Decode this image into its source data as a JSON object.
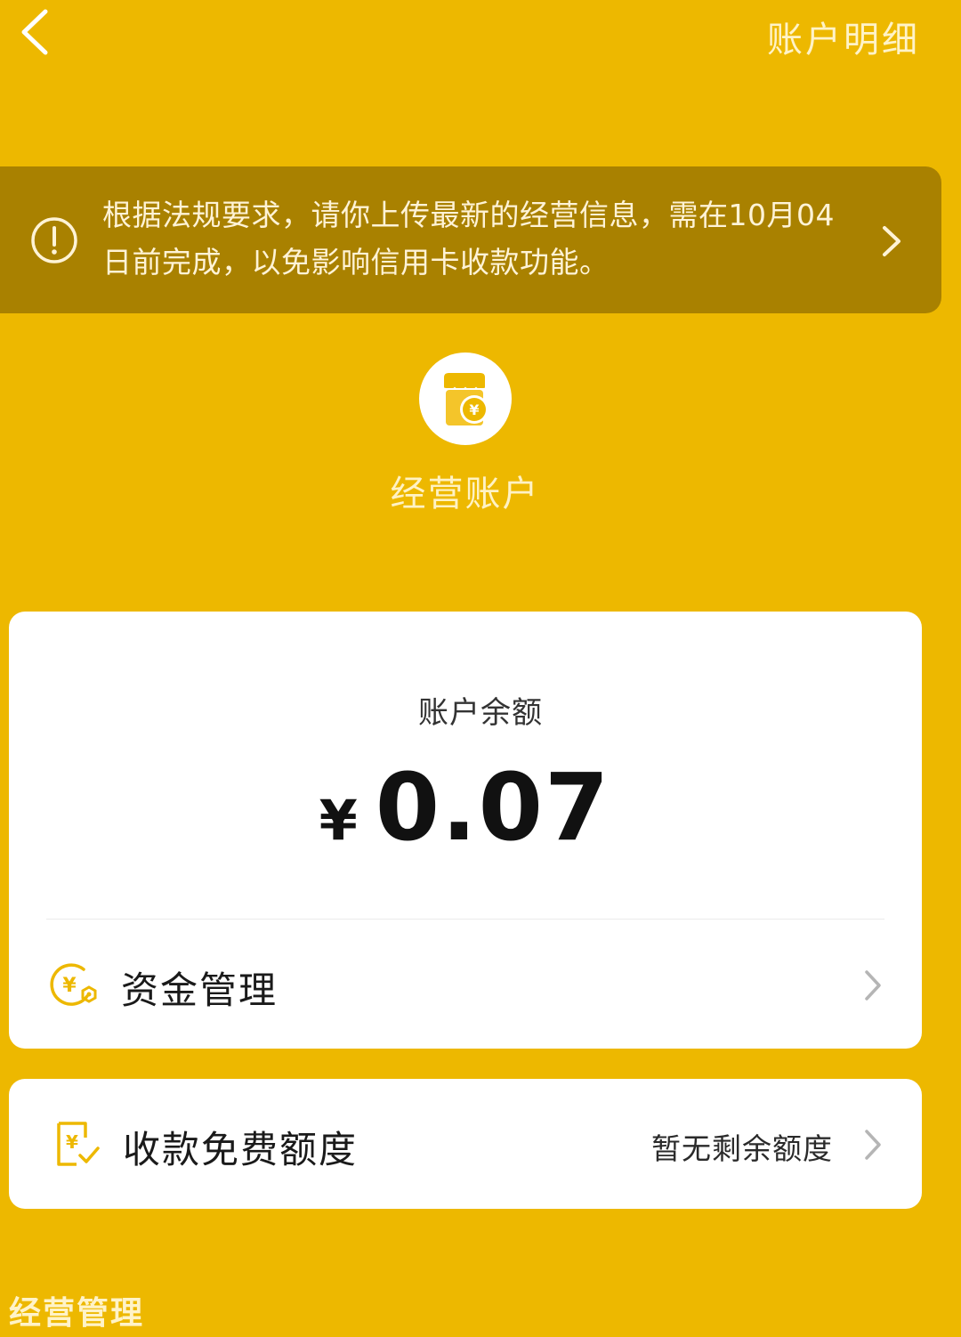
{
  "header": {
    "back_icon": "chevron-left-icon",
    "detail_link": "账户明细"
  },
  "notice": {
    "icon": "exclamation-circle-icon",
    "text": "根据法规要求，请你上传最新的经营信息，需在10月04日前完成，以免影响信用卡收款功能。"
  },
  "account": {
    "avatar_icon": "shop-coin-icon",
    "title": "经营账户"
  },
  "balance": {
    "label": "账户余额",
    "currency": "¥",
    "amount": "0.07"
  },
  "menu": {
    "fund_management": {
      "icon": "yen-coin-gear-icon",
      "label": "资金管理"
    },
    "free_quota": {
      "icon": "yen-receipt-check-icon",
      "label": "收款免费额度",
      "value": "暂无剩余额度"
    }
  },
  "section": {
    "title": "经营管理"
  },
  "colors": {
    "background": "#EDB800",
    "banner": "#A98100",
    "accent": "#EDB800",
    "card": "#FFFFFF"
  }
}
